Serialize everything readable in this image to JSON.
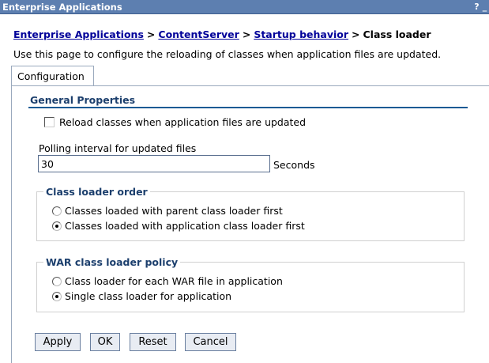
{
  "window": {
    "title": "Enterprise Applications",
    "help_label": "?",
    "minimize_label": "_"
  },
  "breadcrumb": {
    "items": [
      "Enterprise Applications",
      "ContentServer",
      "Startup behavior"
    ],
    "current": "Class loader",
    "separator": ">"
  },
  "description": "Use this page to configure the reloading of classes when application files are updated.",
  "tabs": [
    {
      "label": "Configuration"
    }
  ],
  "general": {
    "title": "General Properties",
    "reload_label": "Reload classes when application files are updated",
    "reload_checked": false,
    "polling_label": "Polling interval for updated files",
    "polling_value": "30",
    "polling_unit": "Seconds"
  },
  "class_loader_order": {
    "title": "Class loader order",
    "options": [
      {
        "label": "Classes loaded with parent class loader first",
        "selected": false
      },
      {
        "label": "Classes loaded with application class loader first",
        "selected": true
      }
    ]
  },
  "war_policy": {
    "title": "WAR class loader policy",
    "options": [
      {
        "label": "Class loader for each WAR file in application",
        "selected": false
      },
      {
        "label": "Single class loader for application",
        "selected": true
      }
    ]
  },
  "buttons": {
    "apply": "Apply",
    "ok": "OK",
    "reset": "Reset",
    "cancel": "Cancel"
  }
}
